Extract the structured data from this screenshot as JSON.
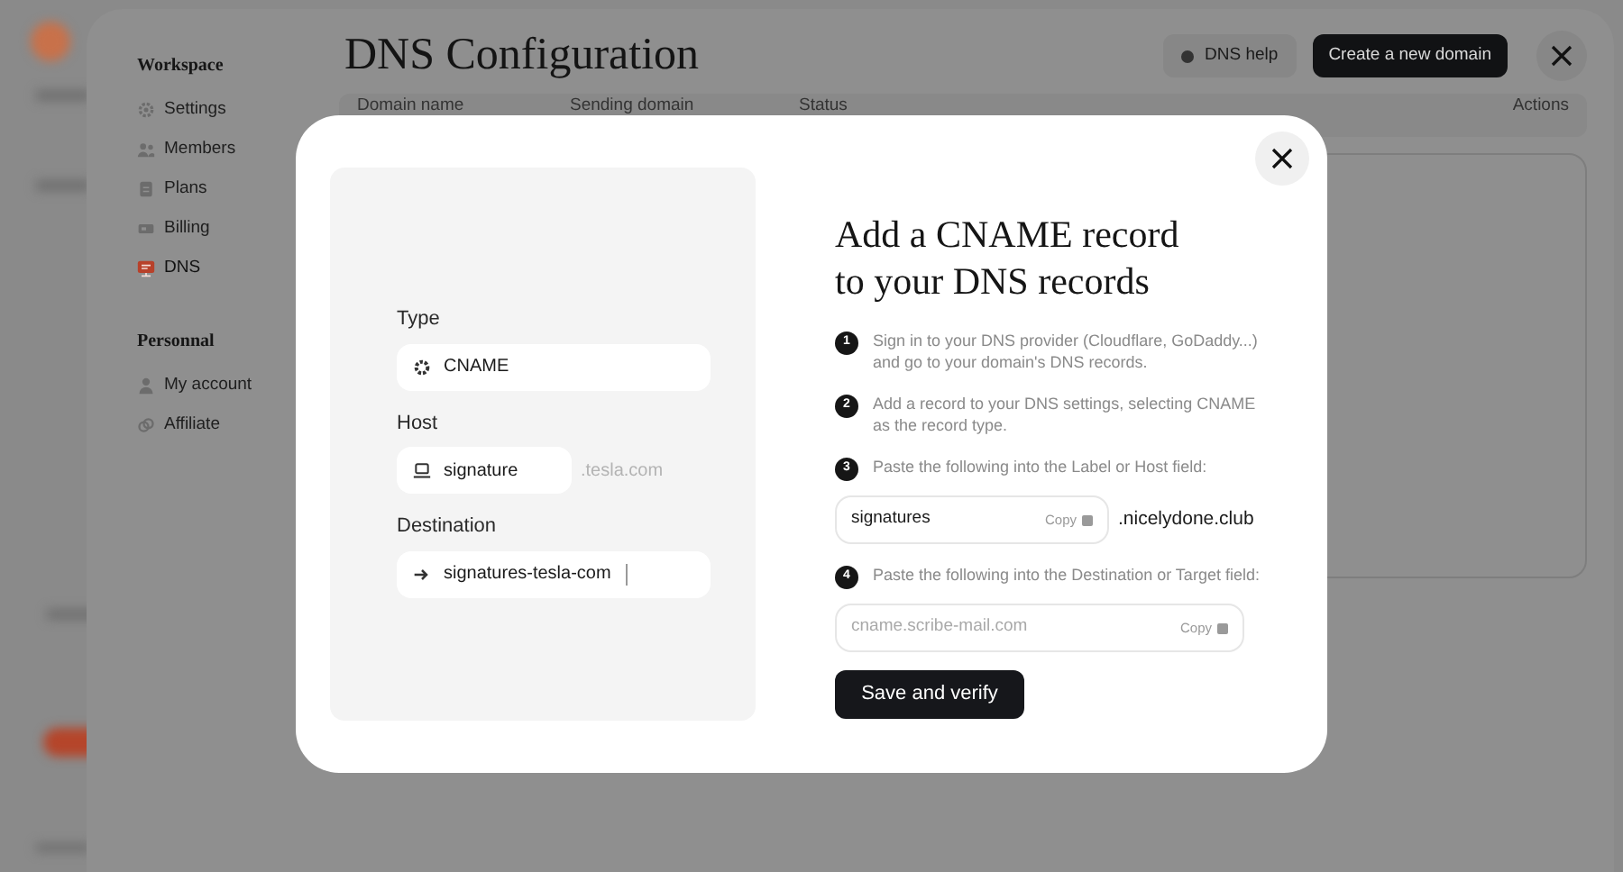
{
  "sidebar": {
    "sections": [
      {
        "title": "Workspace",
        "items": [
          {
            "label": "Settings",
            "selected": false
          },
          {
            "label": "Members",
            "selected": false
          },
          {
            "label": "Plans",
            "selected": false
          },
          {
            "label": "Billing",
            "selected": false
          },
          {
            "label": "DNS",
            "selected": true
          }
        ]
      },
      {
        "title": "Personnal",
        "items": [
          {
            "label": "My account",
            "selected": false
          },
          {
            "label": "Affiliate",
            "selected": false
          }
        ]
      }
    ]
  },
  "header": {
    "title": "DNS Configuration",
    "help_button": "DNS help",
    "create_button": "Create a new domain"
  },
  "table": {
    "columns": [
      "Domain name",
      "Sending domain",
      "Status",
      "Actions"
    ]
  },
  "dialog": {
    "preview": {
      "fields": [
        {
          "kind": "type",
          "label": "Type",
          "value": "CNAME"
        },
        {
          "kind": "host",
          "label": "Host",
          "value": "signature",
          "suffix": ".tesla.com"
        },
        {
          "kind": "destination",
          "label": "Destination",
          "value": "signatures-tesla-com"
        }
      ]
    },
    "title_lines": [
      "Add a CNAME record",
      "to your DNS records"
    ],
    "steps": [
      {
        "number": "1",
        "text": "Sign in to your DNS provider (Cloudflare, GoDaddy...) and go to your domain's DNS records."
      },
      {
        "number": "2",
        "text": "Add a record to your DNS settings, selecting CNAME as the record type."
      },
      {
        "number": "3",
        "text": "Paste the following into the Label or Host field:",
        "field": {
          "value": "signatures",
          "copy": "Copy",
          "suffix": ".nicelydone.club"
        }
      },
      {
        "number": "4",
        "text": "Paste the following into the Destination or Target field:",
        "field": {
          "placeholder": "cname.scribe-mail.com",
          "copy": "Copy"
        }
      }
    ],
    "button": "Save and verify"
  }
}
